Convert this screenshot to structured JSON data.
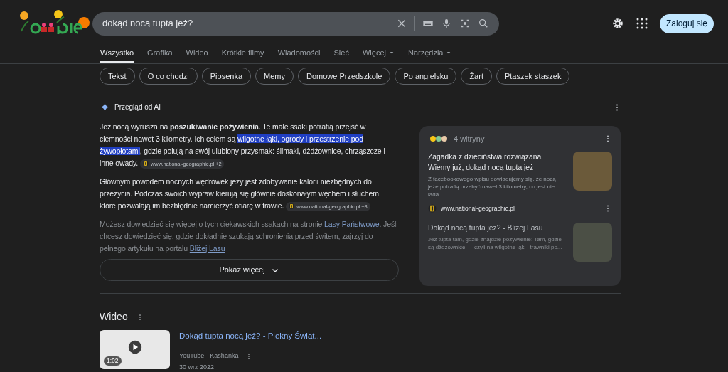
{
  "search": {
    "query": "dokąd nocą tupta jeż?"
  },
  "header": {
    "sign_in": "Zaloguj się"
  },
  "tabs": [
    {
      "label": "Wszystko",
      "selected": true,
      "dropdown": false
    },
    {
      "label": "Grafika",
      "selected": false,
      "dropdown": false
    },
    {
      "label": "Wideo",
      "selected": false,
      "dropdown": false
    },
    {
      "label": "Krótkie filmy",
      "selected": false,
      "dropdown": false
    },
    {
      "label": "Wiadomości",
      "selected": false,
      "dropdown": false
    },
    {
      "label": "Sieć",
      "selected": false,
      "dropdown": false
    },
    {
      "label": "Więcej",
      "selected": false,
      "dropdown": true
    },
    {
      "label": "Narzędzia",
      "selected": false,
      "dropdown": true
    }
  ],
  "chips": [
    "Tekst",
    "O co chodzi",
    "Piosenka",
    "Memy",
    "Domowe Przedszkole",
    "Po angielsku",
    "Żart",
    "Ptaszek staszek"
  ],
  "ai_overview": {
    "title": "Przegląd od AI",
    "paragraphs": [
      {
        "faded": false,
        "segments": [
          {
            "kind": "plain",
            "text": "Jeż nocą wyrusza na "
          },
          {
            "kind": "bold",
            "text": "poszukiwanie pożywienia"
          },
          {
            "kind": "plain",
            "text": ". Te małe ssaki potrafią przejść w ciemności nawet 3 kilometry. Ich celem są "
          },
          {
            "kind": "highlight",
            "text": "wilgotne łąki, ogrody i przestrzenie pod żywopłotami"
          },
          {
            "kind": "plain",
            "text": ", gdzie polują na swój ulubiony przysmak: ślimaki, dżdżownice, chrząszcze i inne owady."
          }
        ],
        "citation": "www.national-geographic.pl +2"
      },
      {
        "faded": false,
        "segments": [
          {
            "kind": "plain",
            "text": "Głównym powodem nocnych wędrówek jeży jest zdobywanie kalorii niezbędnych do przeżycia. Podczas swoich wypraw kierują się głównie doskonałym węchem i słuchem, które pozwalają im bezbłędnie namierzyć ofiarę w trawie."
          }
        ],
        "citation": "www.national-geographic.pl +3"
      },
      {
        "faded": true,
        "segments": [
          {
            "kind": "plain",
            "text": "Możesz dowiedzieć się więcej o tych ciekawskich ssakach na stronie "
          },
          {
            "kind": "link",
            "text": "Lasy Państwowe"
          },
          {
            "kind": "plain",
            "text": ". Jeśli chcesz dowiedzieć się, gdzie dokładnie szukają schronienia przed świtem, zajrzyj do pełnego artykułu na portalu "
          },
          {
            "kind": "link",
            "text": "Bliżej Lasu"
          }
        ]
      }
    ],
    "show_more": "Pokaż więcej",
    "sources": {
      "count": "4 witryny",
      "items": [
        {
          "title": "Zagadka z dzieciństwa rozwiązana. Wiemy już, dokąd nocą tupta jeż",
          "snippet": "Z facebookowego wpisu dowiadujemy się, że nocą jeże potrafią przebyć nawet 3 kilometry, co jest nie lada...",
          "site": "www.national-geographic.pl",
          "faded": false
        },
        {
          "title": "Dokąd nocą tupta jeż? - Bliżej Lasu",
          "snippet": "Jeż tupta tam, gdzie znajdzie pożywienie: Tam, gdzie są dżdżownice — czyli na wilgotne łąki i trawniki po...",
          "faded": true
        }
      ]
    }
  },
  "videos": {
    "title": "Wideo",
    "items": [
      {
        "title": "Dokąd tupta nocą jeż? - Piekny Świat...",
        "source": "YouTube · Kashanka",
        "date": "30 wrz 2022",
        "duration": "1:02"
      }
    ]
  }
}
